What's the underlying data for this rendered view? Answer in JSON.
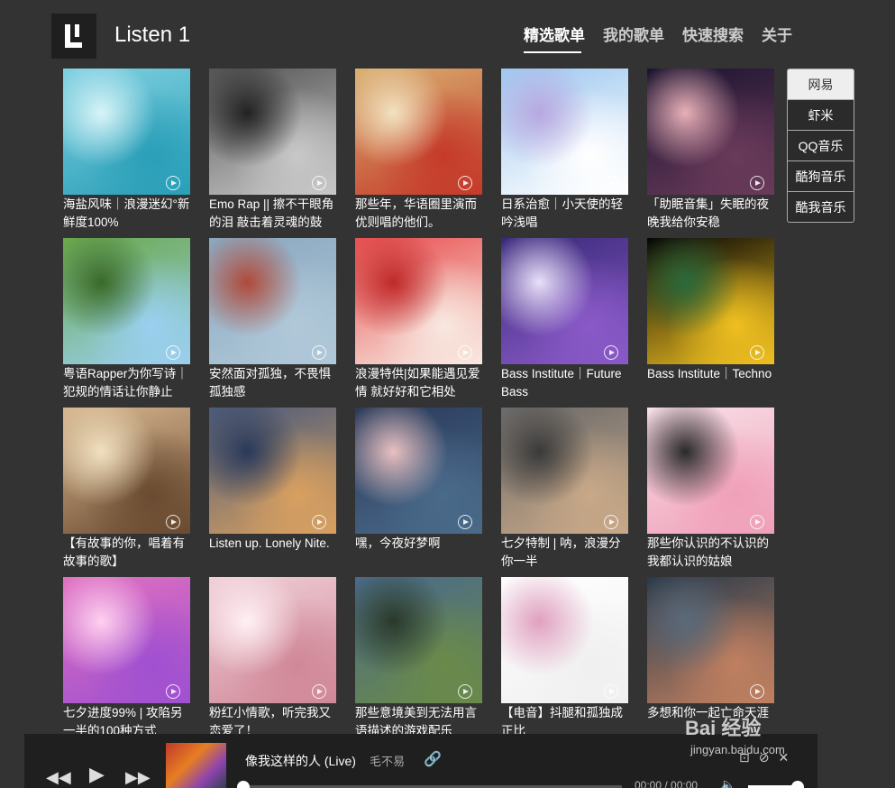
{
  "app": {
    "title": "Listen 1"
  },
  "nav": [
    {
      "label": "精选歌单",
      "active": true
    },
    {
      "label": "我的歌单"
    },
    {
      "label": "快速搜索"
    },
    {
      "label": "关于"
    }
  ],
  "sources": [
    "网易",
    "虾米",
    "QQ音乐",
    "酷狗音乐",
    "酷我音乐"
  ],
  "playlists": [
    {
      "title": "海盐风味｜浪漫迷幻°新鲜度100%",
      "colors": [
        "#7fd0e0",
        "#2a9fb8",
        "#d8f4f8"
      ]
    },
    {
      "title": "Emo Rap || 擦不干眼角的泪 敲击着灵魂的鼓",
      "colors": [
        "#555",
        "#c8c8c8",
        "#222"
      ]
    },
    {
      "title": "那些年，华语圈里演而优则唱的他们。",
      "colors": [
        "#d8b070",
        "#c53a2a",
        "#f2e2c0"
      ]
    },
    {
      "title": "日系治愈｜小天使的轻吟浅唱",
      "colors": [
        "#9ec8f0",
        "#ffffff",
        "#b8a8e0"
      ]
    },
    {
      "title": "「助眠音集」失眠的夜晚我给你安稳",
      "colors": [
        "#1a1430",
        "#6a3a5a",
        "#e8b0b8"
      ]
    },
    {
      "title": "粤语Rapper为你写诗｜犯规的情话让你静止",
      "colors": [
        "#6aa84a",
        "#9ad0f0",
        "#3a6a2a"
      ]
    },
    {
      "title": "安然面对孤独，不畏惧孤独感",
      "colors": [
        "#8aa8c0",
        "#b0c8d8",
        "#b04a3a"
      ]
    },
    {
      "title": "浪漫特供|如果能遇见爱情 就好好和它相处",
      "colors": [
        "#e85050",
        "#f8e8e0",
        "#c02a2a"
      ]
    },
    {
      "title": "Bass Institute｜Future Bass",
      "colors": [
        "#3a2a7a",
        "#8a5ac8",
        "#e8e0f8"
      ]
    },
    {
      "title": "Bass Institute｜Techno",
      "colors": [
        "#050505",
        "#f0c020",
        "#2a6a3a"
      ]
    },
    {
      "title": "【有故事的你，唱着有故事的歌】",
      "colors": [
        "#d8b890",
        "#6a4a30",
        "#f0e0c0"
      ]
    },
    {
      "title": "Listen up. Lonely Nite.",
      "colors": [
        "#4a5a7a",
        "#d8a060",
        "#2a3a5a"
      ]
    },
    {
      "title": "嘿，今夜好梦啊",
      "colors": [
        "#2a3a5a",
        "#4a6a8a",
        "#e8c0c0"
      ]
    },
    {
      "title": "七夕特制 | 呐，浪漫分你一半",
      "colors": [
        "#6a6a6a",
        "#c8a888",
        "#3a3a3a"
      ]
    },
    {
      "title": "那些你认识的不认识的我都认识的姑娘",
      "colors": [
        "#f8e0e8",
        "#f0a0b8",
        "#2a2a2a"
      ]
    },
    {
      "title": "七夕进度99% | 攻陷另一半的100种方式",
      "colors": [
        "#e070c0",
        "#a050d0",
        "#ffd0f0"
      ]
    },
    {
      "title": "粉红小情歌，听完我又恋爱了！",
      "colors": [
        "#f0d0d8",
        "#d08898",
        "#fff0f4"
      ]
    },
    {
      "title": "那些意境美到无法用言语描述的游戏配乐",
      "colors": [
        "#4a6a8a",
        "#6a8a4a",
        "#2a3a2a"
      ]
    },
    {
      "title": "【电音】抖腿和孤独成正比",
      "colors": [
        "#ffffff",
        "#f0f0f0",
        "#e0a0c0"
      ]
    },
    {
      "title": "多想和你一起亡命天涯",
      "colors": [
        "#2a3a4a",
        "#c08060",
        "#5a6a7a"
      ]
    }
  ],
  "player": {
    "song": "像我这样的人 (Live)",
    "artist": "毛不易",
    "time": "00:00 / 00:00",
    "progress": 0,
    "volume": 0.9
  },
  "watermark": {
    "brand": "Bai 经验",
    "url": "jingyan.baidu.com"
  }
}
